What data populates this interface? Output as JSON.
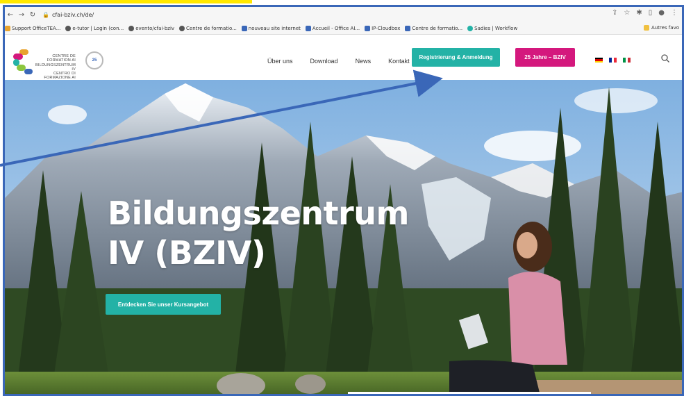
{
  "browser": {
    "url": "cfai-bziv.ch/de/",
    "nav_icons": [
      "back-icon",
      "forward-icon",
      "reload-icon",
      "lock-icon"
    ],
    "right_icons": [
      "share-icon",
      "star-icon",
      "extension-icon",
      "sidebar-icon",
      "profile-icon",
      "menu-icon"
    ]
  },
  "bookmarks": {
    "items": [
      {
        "label": "Support OfficeTEA...",
        "icon": "apps-icon",
        "color": "#e8a32e"
      },
      {
        "label": "e-tutor | Login (con...",
        "icon": "globe-icon",
        "color": "#555555"
      },
      {
        "label": "evento/cfai-bziv",
        "icon": "globe-icon",
        "color": "#555555"
      },
      {
        "label": "Centre de formatio...",
        "icon": "globe-icon",
        "color": "#555555"
      },
      {
        "label": "nouveau site internet",
        "icon": "bookmark-icon",
        "color": "#3a67b8"
      },
      {
        "label": "Accueil - Office AI...",
        "icon": "bookmark-icon",
        "color": "#3a67b8"
      },
      {
        "label": "IP-Cloudbox",
        "icon": "bookmark-icon",
        "color": "#3a67b8"
      },
      {
        "label": "Centre de formatio...",
        "icon": "bookmark-icon",
        "color": "#3a67b8"
      },
      {
        "label": "Sadies | Workflow",
        "icon": "bookmark-icon",
        "color": "#23b2a6"
      }
    ],
    "other": "Autres favo"
  },
  "site": {
    "logo": {
      "line1": "CENTRE DE FORMATION AI",
      "line2": "BILDUNGSZENTRUM IV",
      "line3": "CENTRO DI FORMAZIONE AI",
      "badge": "25"
    },
    "nav": [
      "Über uns",
      "Download",
      "News",
      "Kontakt"
    ],
    "register_label": "Registrierung & Anmeldung",
    "jubilee_label": "25 Jahre – BZIV",
    "languages": [
      {
        "code": "de",
        "colors": [
          "#000000",
          "#dd0000",
          "#ffce00"
        ]
      },
      {
        "code": "fr",
        "colors": [
          "#002395",
          "#ffffff",
          "#ed2939"
        ]
      },
      {
        "code": "it",
        "colors": [
          "#009246",
          "#ffffff",
          "#ce2b37"
        ]
      }
    ],
    "search_icon": "search-icon"
  },
  "hero": {
    "title_line1": "Bildungszentrum",
    "title_line2": "IV (BZIV)",
    "cta_label": "Entdecken Sie unser Kursangebot"
  },
  "colors": {
    "accent_teal": "#23b2a6",
    "accent_magenta": "#d4187d",
    "annotation_blue": "#3a67b8",
    "highlight_yellow": "#ffe800"
  }
}
